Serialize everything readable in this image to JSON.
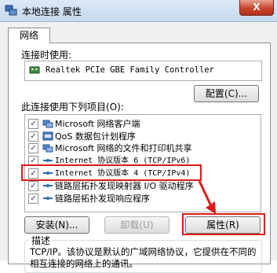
{
  "window": {
    "title": "本地连接 属性",
    "close_glyph": "X"
  },
  "tabs": [
    {
      "label": "网络"
    }
  ],
  "connect_using": {
    "label": "连接时使用:",
    "adapter": "Realtek PCIe GBE Family Controller"
  },
  "configure_button": "配置(C)...",
  "items_label": "此连接使用下列项目(O):",
  "items": [
    {
      "label": "Microsoft 网络客户端",
      "checked": true,
      "icon": "network-client-icon"
    },
    {
      "label": "QoS 数据包计划程序",
      "checked": true,
      "icon": "qos-icon"
    },
    {
      "label": "Microsoft 网络的文件和打印机共享",
      "checked": true,
      "icon": "file-share-icon"
    },
    {
      "label": "Internet 协议版本 6 (TCP/IPv6)",
      "checked": true,
      "icon": "protocol-icon"
    },
    {
      "label": "Internet 协议版本 4 (TCP/IPv4)",
      "checked": true,
      "icon": "protocol-icon"
    },
    {
      "label": "链路层拓扑发现映射器 I/O 驱动程序",
      "checked": true,
      "icon": "protocol-icon"
    },
    {
      "label": "链路层拓扑发现响应程序",
      "checked": true,
      "icon": "protocol-icon"
    }
  ],
  "buttons": {
    "install": "安装(N)...",
    "uninstall": "卸载(U)",
    "properties": "属性(R)"
  },
  "description": {
    "title": "描述",
    "text": "TCP/IP。该协议是默认的广域网络协议，它提供在不同的相互连接的网络上的通讯。"
  },
  "colors": {
    "highlight": "#e01a1a"
  }
}
